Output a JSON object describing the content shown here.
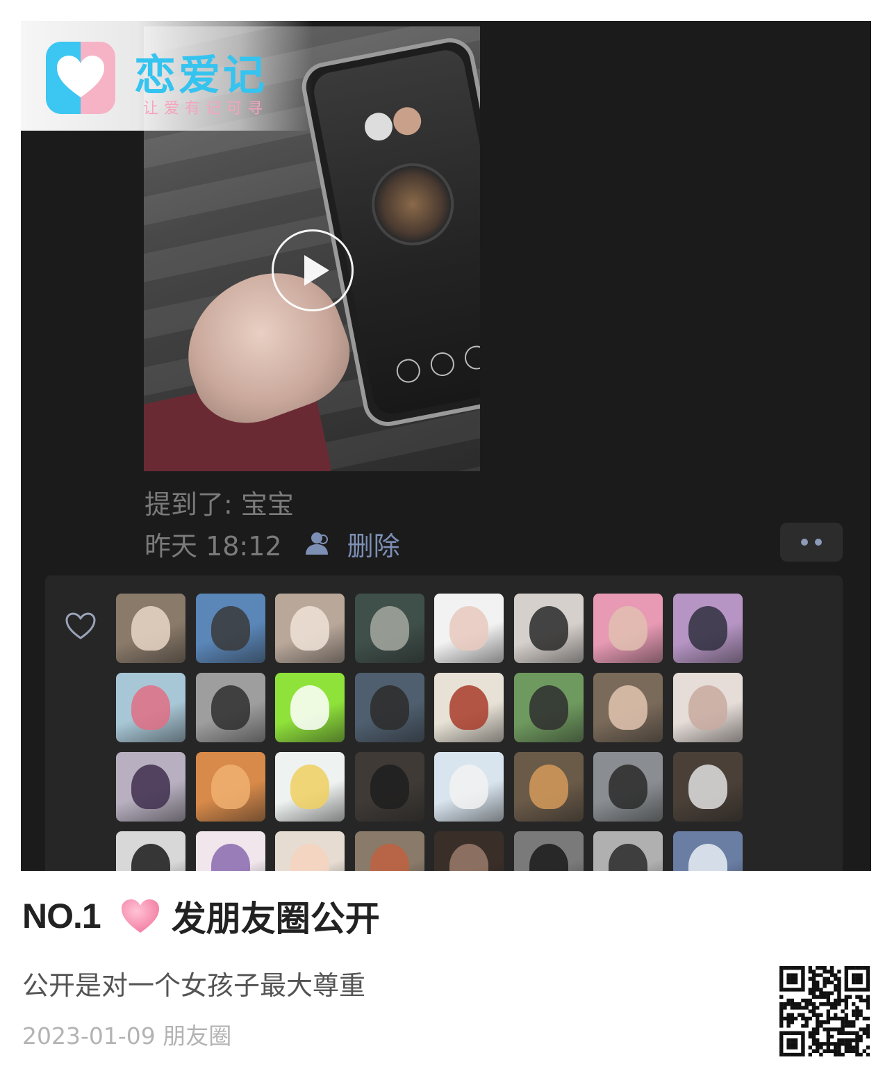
{
  "watermark": {
    "app_name": "恋爱记",
    "slogan": "让爱有记可寻"
  },
  "post": {
    "mention_text": "提到了: 宝宝",
    "time_text": "昨天 18:12",
    "delete_label": "删除"
  },
  "likes": {
    "avatars": [
      {
        "bg": "#8a7a6a",
        "fg": "#e8d6c6"
      },
      {
        "bg": "#5a86b8",
        "fg": "#3a3a3a"
      },
      {
        "bg": "#b9a89a",
        "fg": "#efe2d6"
      },
      {
        "bg": "#3f4f4a",
        "fg": "#a4a8a0"
      },
      {
        "bg": "#f2f2f2",
        "fg": "#e7c9bd"
      },
      {
        "bg": "#d6d0cc",
        "fg": "#2a2a2a"
      },
      {
        "bg": "#e89ab4",
        "fg": "#e0c0b0"
      },
      {
        "bg": "#b695c4",
        "fg": "#303040"
      },
      {
        "bg": "#a8c7d6",
        "fg": "#e06f86"
      },
      {
        "bg": "#9e9e9e",
        "fg": "#2f2f2f"
      },
      {
        "bg": "#8fe23a",
        "fg": "#ffffff"
      },
      {
        "bg": "#4f5f6f",
        "fg": "#2c2c2c"
      },
      {
        "bg": "#e8e2d6",
        "fg": "#a83c2c"
      },
      {
        "bg": "#6f9a5f",
        "fg": "#2f2f2f"
      },
      {
        "bg": "#7a6a5a",
        "fg": "#e2c4b0"
      },
      {
        "bg": "#e6ddd8",
        "fg": "#c8aaa0"
      },
      {
        "bg": "#b8b0c0",
        "fg": "#3f2f4f"
      },
      {
        "bg": "#d88a4a",
        "fg": "#f0b070"
      },
      {
        "bg": "#eef2f0",
        "fg": "#f0d060"
      },
      {
        "bg": "#3f3a36",
        "fg": "#1f1f1f"
      },
      {
        "bg": "#d8e4ee",
        "fg": "#f2f2f2"
      },
      {
        "bg": "#6a5a48",
        "fg": "#d49a5a"
      },
      {
        "bg": "#8a8e92",
        "fg": "#2a2a2a"
      },
      {
        "bg": "#4a4038",
        "fg": "#e0e0e0"
      },
      {
        "bg": "#d8d8d8",
        "fg": "#1a1a1a"
      },
      {
        "bg": "#f0e6ec",
        "fg": "#8a6ab0"
      },
      {
        "bg": "#e6dcd2",
        "fg": "#f4d4c0"
      },
      {
        "bg": "#8a7a6a",
        "fg": "#c06040"
      },
      {
        "bg": "#3a2e28",
        "fg": "#9a7a6a"
      },
      {
        "bg": "#7a7a7a",
        "fg": "#1a1a1a"
      },
      {
        "bg": "#b0b0b0",
        "fg": "#2a2a2a"
      },
      {
        "bg": "#6a7ea4",
        "fg": "#e8eef4"
      }
    ]
  },
  "article": {
    "rank": "NO.1",
    "title": "发朋友圈公开",
    "subtitle": "公开是对一个女孩子最大尊重",
    "date_source": "2023-01-09 朋友圈"
  },
  "colors": {
    "panel_bg": "#1b1b1b",
    "likes_bg": "#262626",
    "link_blue": "#7d8fb5",
    "muted_text": "#7b7b7b",
    "heart_pink": "#f58fb0",
    "brand_blue": "#35c3ef",
    "brand_pink": "#f7b3c6"
  },
  "icons": {
    "play": "play-icon",
    "visibility": "people-icon",
    "more": "more-dots-icon",
    "like": "heart-outline-icon",
    "title_heart": "pink-heart-icon",
    "qr": "qr-code-icon"
  }
}
